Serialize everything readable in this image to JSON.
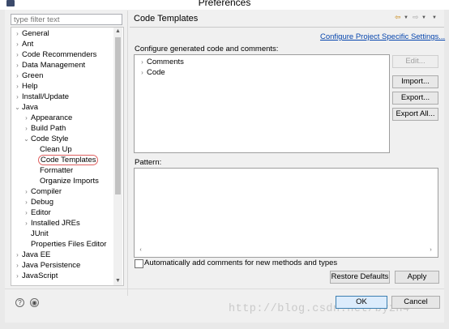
{
  "window": {
    "title": "Preferences"
  },
  "filter": {
    "placeholder": "type filter text"
  },
  "tree": {
    "general": "General",
    "ant": "Ant",
    "code_recommenders": "Code Recommenders",
    "data_management": "Data Management",
    "green": "Green",
    "help": "Help",
    "install_update": "Install/Update",
    "java": "Java",
    "appearance": "Appearance",
    "build_path": "Build Path",
    "code_style": "Code Style",
    "clean_up": "Clean Up",
    "code_templates": "Code Templates",
    "formatter": "Formatter",
    "organize_imports": "Organize Imports",
    "compiler": "Compiler",
    "debug": "Debug",
    "editor": "Editor",
    "installed_jres": "Installed JREs",
    "junit": "JUnit",
    "properties_files_editor": "Properties Files Editor",
    "java_ee": "Java EE",
    "java_persistence": "Java Persistence",
    "javascript": "JavaScript"
  },
  "page": {
    "title": "Code Templates",
    "link": "Configure Project Specific Settings...",
    "config_label": "Configure generated code and comments:",
    "templates": [
      "Comments",
      "Code"
    ],
    "pattern_label": "Pattern:",
    "auto_comments": "Automatically add comments for new methods and types"
  },
  "buttons": {
    "edit": "Edit...",
    "import": "Import...",
    "export": "Export...",
    "export_all": "Export All...",
    "restore_defaults": "Restore Defaults",
    "apply": "Apply",
    "ok": "OK",
    "cancel": "Cancel"
  },
  "watermark": "http://blog.csdn.net/byzh4",
  "icons": {
    "help": "help-icon",
    "import_export": "import-export-icon",
    "back": "back-arrow-icon",
    "forward": "forward-arrow-icon",
    "menu": "view-menu-icon"
  },
  "colors": {
    "link": "#0645ad",
    "selection_ring": "#e06060",
    "ok_border": "#3c7fb1"
  }
}
